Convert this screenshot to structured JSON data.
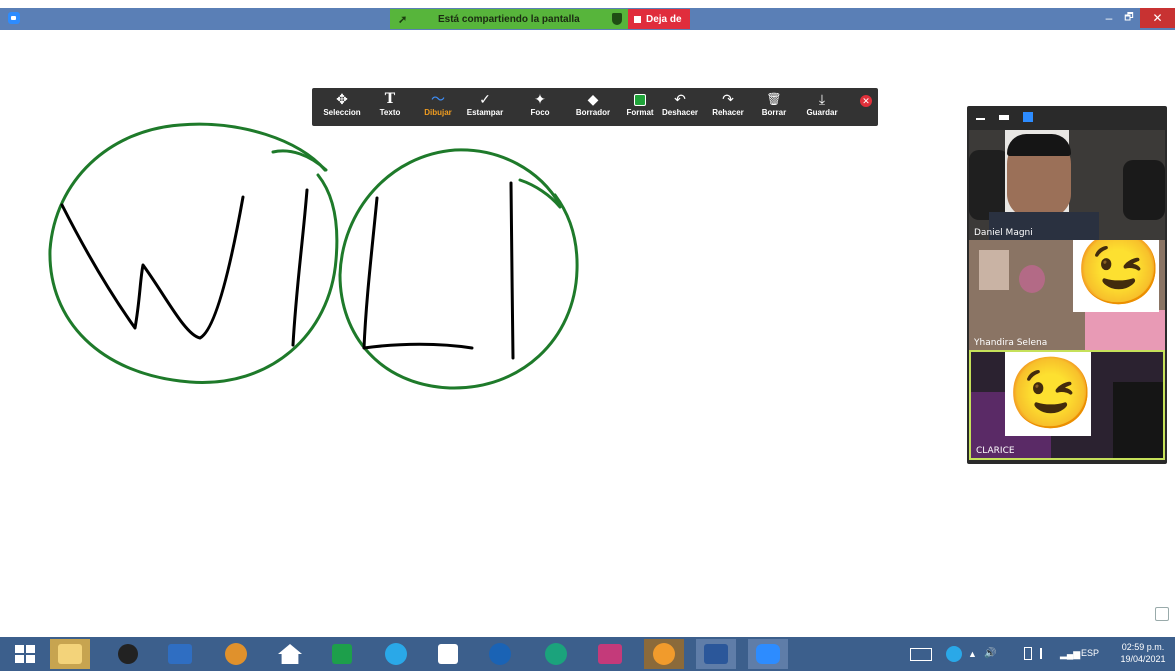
{
  "top_bar": {
    "share_status": "Está compartiendo la pantalla",
    "stop_share_label": "Deja de",
    "window_min": "–",
    "window_restore": "🗗",
    "window_close": "✕"
  },
  "annotation_toolbar": {
    "tools": [
      {
        "label": "Seleccion",
        "icon": "✥"
      },
      {
        "label": "Texto",
        "icon": "T"
      },
      {
        "label": "Dibujar",
        "icon": "〜"
      },
      {
        "label": "Estampar",
        "icon": "✓"
      },
      {
        "label": "Foco",
        "icon": "✦"
      },
      {
        "label": "Borrador",
        "icon": "◆"
      },
      {
        "label": "Format",
        "icon": "▢"
      },
      {
        "label": "Deshacer",
        "icon": "↶"
      },
      {
        "label": "Rehacer",
        "icon": "↷"
      },
      {
        "label": "Borrar",
        "icon": "🗑"
      },
      {
        "label": "Guardar",
        "icon": "⤓"
      }
    ],
    "active_tool": "Dibujar",
    "close_icon": "✕"
  },
  "drawing": {
    "stroke_colors": {
      "circle": "#1e7a2a",
      "letters": "#000000"
    }
  },
  "video_panel": {
    "participants": [
      {
        "name": "Daniel Magni"
      },
      {
        "name": "Yhandira Selena"
      },
      {
        "name": "CLARICE"
      }
    ],
    "emoji": "😉"
  },
  "taskbar": {
    "language": "ESP",
    "time": "02:59 p.m.",
    "date": "19/04/2021"
  }
}
